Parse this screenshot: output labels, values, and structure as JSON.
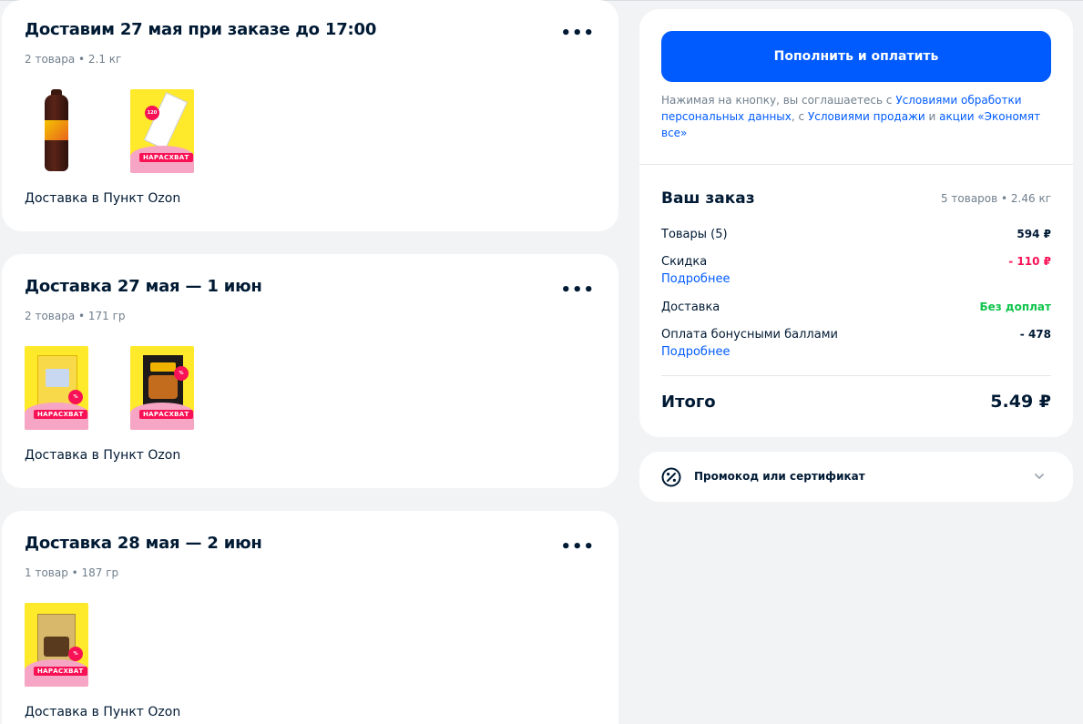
{
  "shipments": [
    {
      "title": "Доставим 27 мая при заказе до 17:00",
      "meta": "2 товара • 2.1 кг",
      "more": "•••",
      "tags": [
        "",
        "НАРАСХВАТ"
      ],
      "footer": "Доставка в Пункт Ozon"
    },
    {
      "title": "Доставка 27 мая — 1 июн",
      "meta": "2 товара • 171 гр",
      "more": "•••",
      "tags": [
        "НАРАСХВАТ",
        "НАРАСХВАТ"
      ],
      "footer": "Доставка в Пункт Ozon"
    },
    {
      "title": "Доставка 28 мая — 2 июн",
      "meta": "1 товар • 187 гр",
      "more": "•••",
      "tags": [
        "НАРАСХВАТ"
      ],
      "footer": "Доставка в Пункт Ozon"
    }
  ],
  "summary": {
    "pay_button": "Пополнить и оплатить",
    "legal": {
      "t1": "Нажимая на кнопку, вы соглашаетесь с ",
      "l1": "Условиями обработки персональных данных",
      "t2": ", с ",
      "l2": "Условиями продажи",
      "t3": " и ",
      "l3": "акции «Экономят все»"
    },
    "order_title": "Ваш заказ",
    "order_meta": "5 товаров • 2.46 кг",
    "rows": {
      "goods_label": "Товары (5)",
      "goods_value": "594 ₽",
      "discount_label": "Скидка",
      "discount_value": "- 110 ₽",
      "discount_more": "Подробнее",
      "delivery_label": "Доставка",
      "delivery_value": "Без доплат",
      "bonus_label": "Оплата бонусными баллами",
      "bonus_value": "- 478",
      "bonus_more": "Подробнее"
    },
    "total_label": "Итого",
    "total_value": "5.49 ₽"
  },
  "promo": {
    "label": "Промокод или сертификат",
    "icon": "percent-icon"
  },
  "colors": {
    "accent": "#005bff",
    "discount": "#f91155",
    "free_delivery": "#10c44c",
    "tag": "#f91155",
    "background": "#f2f3f5"
  }
}
